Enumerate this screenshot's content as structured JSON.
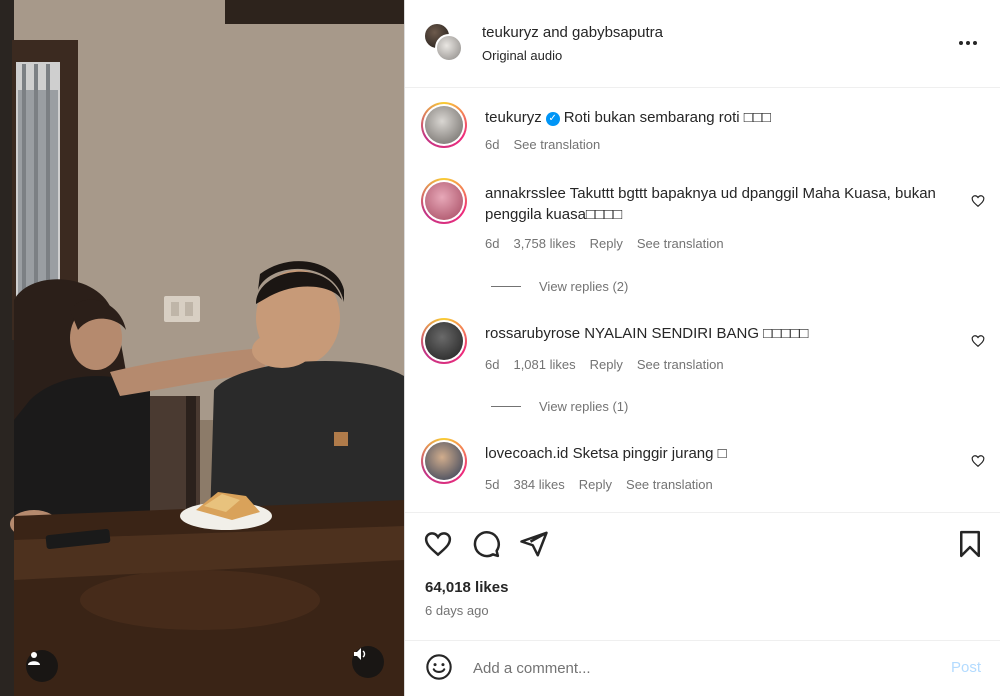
{
  "header": {
    "title": "teukuryz and gabybsaputra",
    "subtitle": "Original audio",
    "more_icon": "more-horizontal-icon"
  },
  "caption": {
    "username": "teukuryz",
    "text": "Roti bukan sembarang roti □□□",
    "time": "6d",
    "translate": "See translation"
  },
  "comments": [
    {
      "username": "annakrsslee",
      "text": "Takuttt bgttt bapaknya ud dpanggil Maha Kuasa, bukan penggila kuasa□□□□",
      "time": "6d",
      "likes": "3,758 likes",
      "reply": "Reply",
      "translate": "See translation",
      "view_replies": "View replies (2)"
    },
    {
      "username": "rossarubyrose",
      "text": "NYALAIN SENDIRI BANG □□□□□",
      "time": "6d",
      "likes": "1,081 likes",
      "reply": "Reply",
      "translate": "See translation",
      "view_replies": "View replies (1)"
    },
    {
      "username": "lovecoach.id",
      "text": "Sketsa pinggir jurang □",
      "time": "5d",
      "likes": "384 likes",
      "reply": "Reply",
      "translate": "See translation"
    }
  ],
  "actions": {
    "likes": "64,018 likes",
    "time_ago": "6 days ago"
  },
  "composer": {
    "placeholder": "Add a comment...",
    "post_label": "Post"
  },
  "colors": {
    "accent": "#0095f6",
    "post_disabled": "#b3dbff",
    "muted_text": "#737373"
  }
}
